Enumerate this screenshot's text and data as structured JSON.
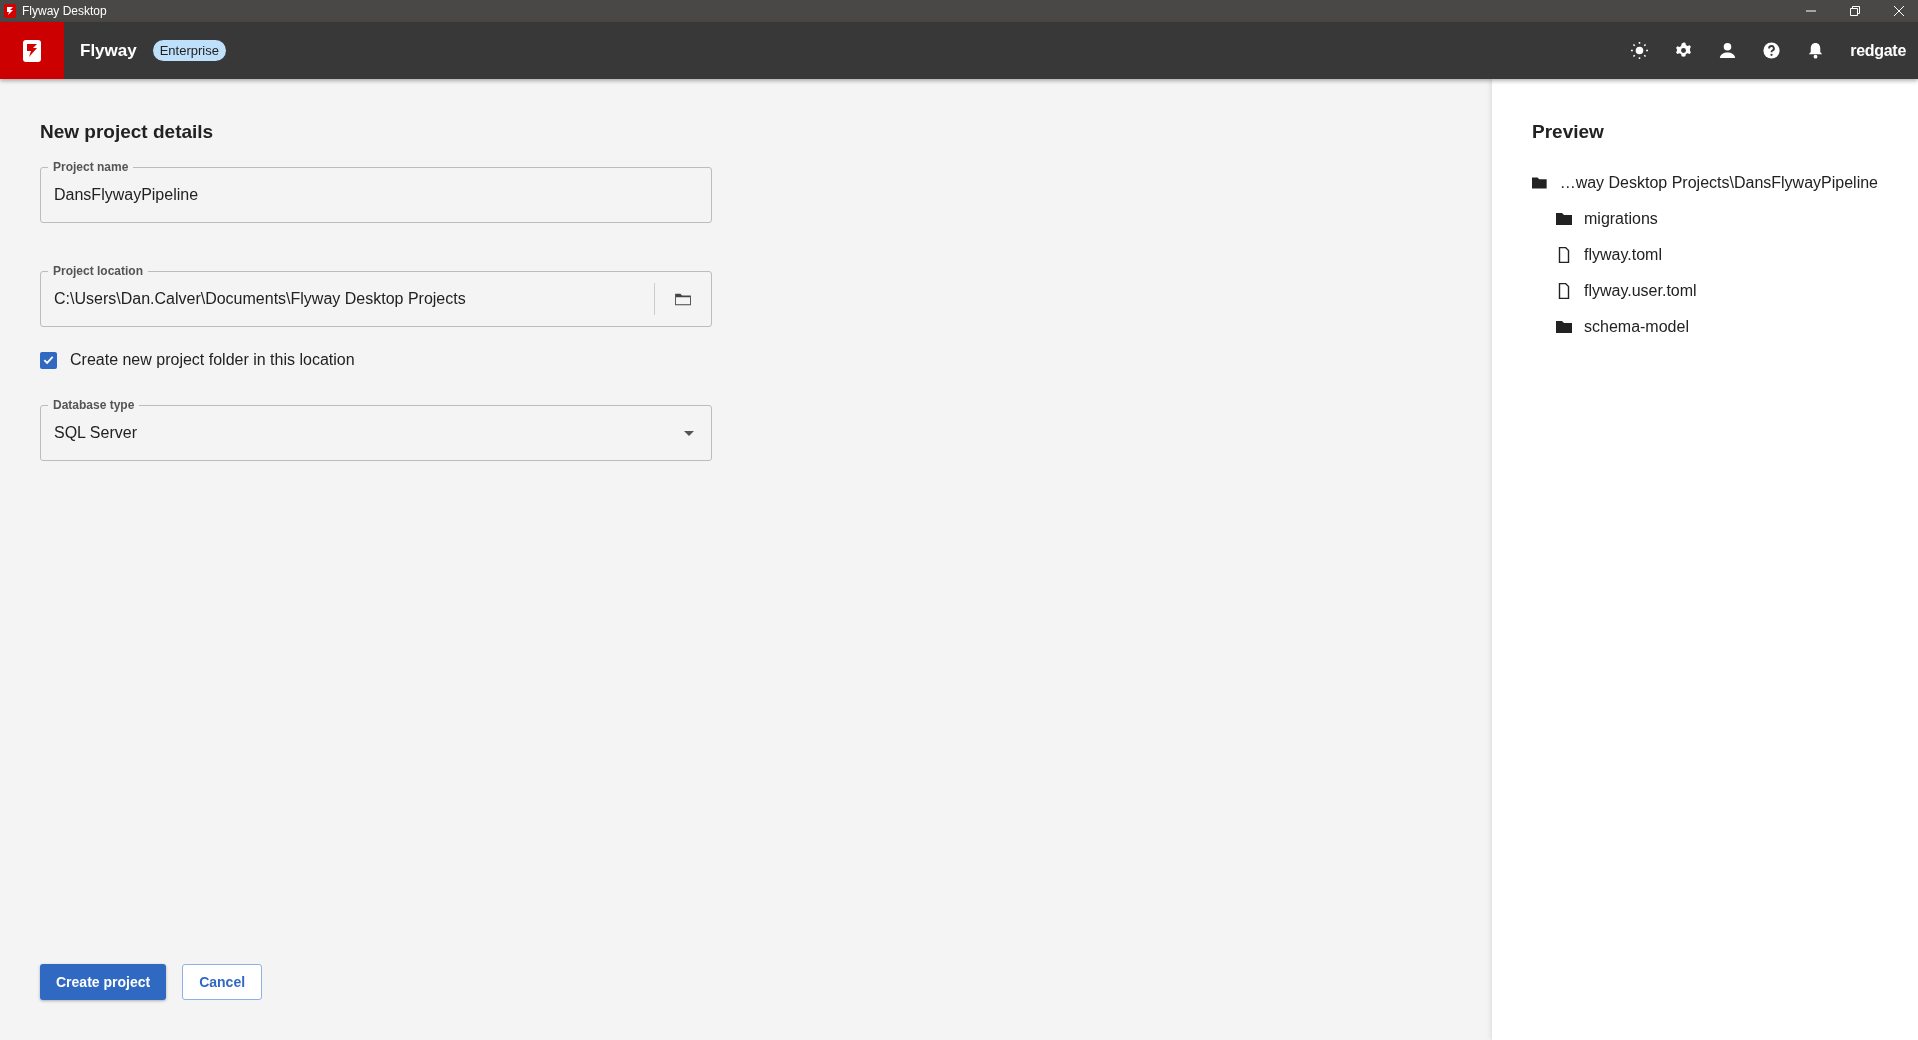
{
  "window": {
    "title": "Flyway Desktop"
  },
  "header": {
    "product": "Flyway",
    "edition": "Enterprise",
    "brand": "redgate"
  },
  "form": {
    "title": "New project details",
    "fields": [
      {
        "kind": "text",
        "label": "Project name",
        "value": "DansFlywayPipeline"
      },
      {
        "kind": "browse",
        "label": "Project location",
        "value": "C:\\Users\\Dan.Calver\\Documents\\Flyway Desktop Projects"
      },
      {
        "kind": "checkbox",
        "label": "Create new project folder in this location",
        "checked": true
      },
      {
        "kind": "select",
        "label": "Database type",
        "value": "SQL Server"
      }
    ],
    "buttons": [
      {
        "label": "Create project",
        "kind": "primary"
      },
      {
        "label": "Cancel",
        "kind": "secondary"
      }
    ]
  },
  "preview": {
    "title": "Preview",
    "tree": [
      {
        "name": "…way Desktop Projects\\DansFlywayPipeline",
        "kind": "folder",
        "children": [
          {
            "name": "migrations",
            "kind": "folder"
          },
          {
            "name": "flyway.toml",
            "kind": "file"
          },
          {
            "name": "flyway.user.toml",
            "kind": "file"
          },
          {
            "name": "schema-model",
            "kind": "folder"
          }
        ]
      }
    ]
  }
}
